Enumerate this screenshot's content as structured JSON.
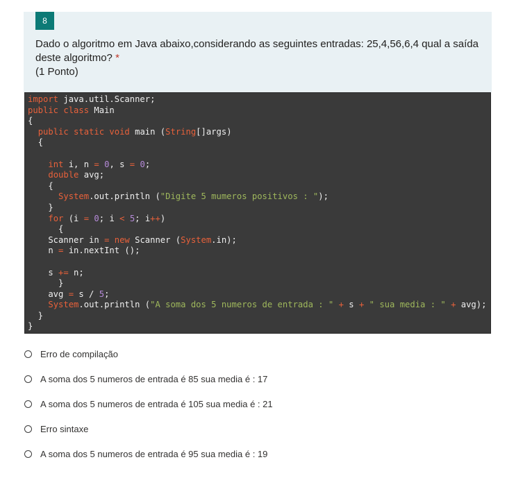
{
  "question": {
    "number": "8",
    "text": "Dado o algoritmo em Java abaixo,considerando as seguintes entradas: 25,4,56,6,4 qual a saída deste algoritmo?",
    "required_mark": "*",
    "points": "(1 Ponto)"
  },
  "code": {
    "lines": [
      [
        [
          "kw",
          "import"
        ],
        [
          "t",
          " java.util.Scanner;"
        ]
      ],
      [
        [
          "kw",
          "public class"
        ],
        [
          "t",
          " Main"
        ]
      ],
      [
        [
          "t",
          "{"
        ]
      ],
      [
        [
          "t",
          "  "
        ],
        [
          "kw",
          "public static void"
        ],
        [
          "t",
          " main ("
        ],
        [
          "kw",
          "String"
        ],
        [
          "t",
          "[]args)"
        ]
      ],
      [
        [
          "t",
          "  {"
        ]
      ],
      [
        [
          "t",
          ""
        ]
      ],
      [
        [
          "t",
          "    "
        ],
        [
          "kw",
          "int"
        ],
        [
          "t",
          " i, n "
        ],
        [
          "op",
          "="
        ],
        [
          "t",
          " "
        ],
        [
          "num",
          "0"
        ],
        [
          "t",
          ", s "
        ],
        [
          "op",
          "="
        ],
        [
          "t",
          " "
        ],
        [
          "num",
          "0"
        ],
        [
          "t",
          ";"
        ]
      ],
      [
        [
          "t",
          "    "
        ],
        [
          "kw",
          "double"
        ],
        [
          "t",
          " avg;"
        ]
      ],
      [
        [
          "t",
          "    {"
        ]
      ],
      [
        [
          "t",
          "      "
        ],
        [
          "kw",
          "System"
        ],
        [
          "t",
          ".out.println ("
        ],
        [
          "str",
          "\"Digite 5 mumeros positivos : \""
        ],
        [
          "t",
          ");"
        ]
      ],
      [
        [
          "t",
          "    }"
        ]
      ],
      [
        [
          "t",
          "    "
        ],
        [
          "kw",
          "for"
        ],
        [
          "t",
          " (i "
        ],
        [
          "op",
          "="
        ],
        [
          "t",
          " "
        ],
        [
          "num",
          "0"
        ],
        [
          "t",
          "; i "
        ],
        [
          "op",
          "<"
        ],
        [
          "t",
          " "
        ],
        [
          "num",
          "5"
        ],
        [
          "t",
          "; i"
        ],
        [
          "op",
          "++"
        ],
        [
          "t",
          ")"
        ]
      ],
      [
        [
          "t",
          "      {"
        ]
      ],
      [
        [
          "t",
          "    Scanner in "
        ],
        [
          "op",
          "="
        ],
        [
          "t",
          " "
        ],
        [
          "kw",
          "new"
        ],
        [
          "t",
          " Scanner ("
        ],
        [
          "kw",
          "System"
        ],
        [
          "t",
          ".in);"
        ]
      ],
      [
        [
          "t",
          "    n "
        ],
        [
          "op",
          "="
        ],
        [
          "t",
          " in.nextInt ();"
        ]
      ],
      [
        [
          "t",
          ""
        ]
      ],
      [
        [
          "t",
          "    s "
        ],
        [
          "op",
          "+="
        ],
        [
          "t",
          " n;"
        ]
      ],
      [
        [
          "t",
          "      }"
        ]
      ],
      [
        [
          "t",
          "    avg "
        ],
        [
          "op",
          "="
        ],
        [
          "t",
          " s / "
        ],
        [
          "num",
          "5"
        ],
        [
          "t",
          ";"
        ]
      ],
      [
        [
          "t",
          "    "
        ],
        [
          "kw",
          "System"
        ],
        [
          "t",
          ".out.println ("
        ],
        [
          "str",
          "\"A soma dos 5 numeros de entrada : \""
        ],
        [
          "t",
          " "
        ],
        [
          "op",
          "+"
        ],
        [
          "t",
          " s "
        ],
        [
          "op",
          "+"
        ],
        [
          "t",
          " "
        ],
        [
          "str",
          "\" sua media : \""
        ],
        [
          "t",
          " "
        ],
        [
          "op",
          "+"
        ],
        [
          "t",
          " avg);"
        ]
      ],
      [
        [
          "t",
          "  }"
        ]
      ],
      [
        [
          "t",
          "}"
        ]
      ]
    ]
  },
  "options": [
    {
      "label": "Erro de compilação"
    },
    {
      "label": "A soma dos 5 numeros de entrada é 85 sua media é : 17"
    },
    {
      "label": "A soma dos 5 numeros de entrada é 105 sua media é : 21"
    },
    {
      "label": "Erro sintaxe"
    },
    {
      "label": "A soma dos 5 numeros de entrada é 95 sua media é : 19"
    }
  ],
  "colors": {
    "header_bg": "#e9f1f4",
    "badge": "#0c7a76",
    "code_bg": "#3a3a3a",
    "keyword": "#e8613a",
    "number": "#b58ad8",
    "string": "#9fb85c",
    "required": "#c0392b"
  }
}
